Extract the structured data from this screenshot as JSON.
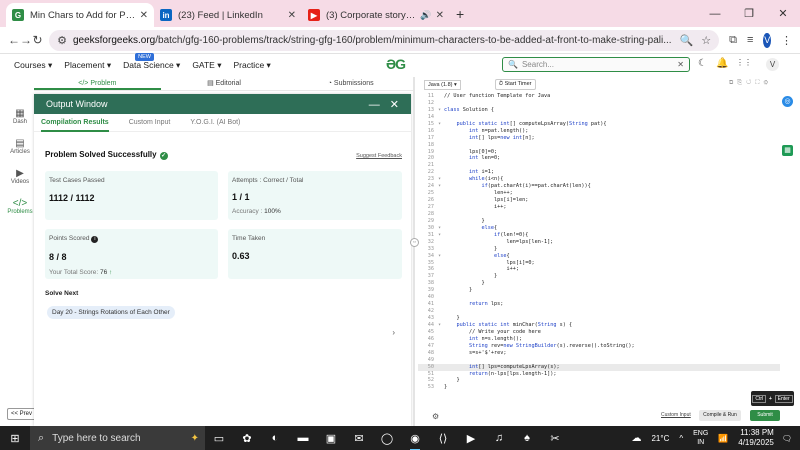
{
  "browser": {
    "tabs": [
      {
        "title": "Min Chars to Add for Palindrom",
        "active": true,
        "fav": "gg"
      },
      {
        "title": "(23) Feed | LinkedIn",
        "active": false,
        "fav": "in"
      },
      {
        "title": "(3) Corporate story | Standu",
        "active": false,
        "fav": "yt"
      }
    ],
    "url_domain": "geeksforgeeks.org",
    "url_path": "/batch/gfg-160-problems/track/string-gfg-160/problem/minimum-characters-to-be-added-at-front-to-make-string-pali...",
    "profile": "V"
  },
  "site": {
    "menu": [
      "Courses",
      "Placement",
      "Data Science",
      "GATE",
      "Practice"
    ],
    "new_badge": "NEW",
    "logo": "GG",
    "search_placeholder": "Search...",
    "profile": "V"
  },
  "problem_tabs": [
    "Problem",
    "Editorial",
    "Submissions"
  ],
  "sidebar": [
    {
      "icon": "▦",
      "label": "Dash"
    },
    {
      "icon": "▤",
      "label": "Articles"
    },
    {
      "icon": "▶",
      "label": "Videos"
    },
    {
      "icon": "</>",
      "label": "Problems"
    }
  ],
  "prev_label": "<< Prev",
  "output": {
    "title": "Output Window",
    "tabs": [
      "Compilation Results",
      "Custom Input",
      "Y.O.G.I. (AI Bot)"
    ],
    "status": "Problem Solved Successfully",
    "feedback": "Suggest Feedback",
    "test_cases_label": "Test Cases Passed",
    "test_cases_value": "1112 / 1112",
    "attempts_label": "Attempts : Correct / Total",
    "attempts_value": "1 / 1",
    "accuracy_label": "Accuracy :",
    "accuracy_value": "100%",
    "points_label": "Points Scored",
    "points_value": "8 / 8",
    "total_score_label": "Your Total Score:",
    "total_score_value": "76",
    "time_label": "Time Taken",
    "time_value": "0.63",
    "solve_next": "Solve Next",
    "next_problem": "Day 20 - Strings Rotations of Each Other"
  },
  "editor": {
    "language": "Java (1.8)",
    "timer": "Start Timer",
    "custom_input": "Custom Input",
    "compile_run": "Compile & Run",
    "submit": "Submit",
    "shortcut_ctrl": "Ctrl",
    "shortcut_plus": "+",
    "shortcut_enter": "Enter",
    "lines": [
      {
        "n": "11",
        "f": "",
        "t": "// User function Template for Java",
        "c": "cm"
      },
      {
        "n": "12",
        "f": "",
        "t": ""
      },
      {
        "n": "13",
        "f": "▾",
        "t": "class Solution {"
      },
      {
        "n": "14",
        "f": "",
        "t": ""
      },
      {
        "n": "15",
        "f": "▾",
        "t": "    public static int[] computeLpsArray(String pat){"
      },
      {
        "n": "16",
        "f": "",
        "t": "        int n=pat.length();"
      },
      {
        "n": "17",
        "f": "",
        "t": "        int[] lps=new int[n];"
      },
      {
        "n": "18",
        "f": "",
        "t": ""
      },
      {
        "n": "19",
        "f": "",
        "t": "        lps[0]=0;"
      },
      {
        "n": "20",
        "f": "",
        "t": "        int len=0;"
      },
      {
        "n": "21",
        "f": "",
        "t": ""
      },
      {
        "n": "22",
        "f": "",
        "t": "        int i=1;"
      },
      {
        "n": "23",
        "f": "▾",
        "t": "        while(i<n){"
      },
      {
        "n": "24",
        "f": "▾",
        "t": "            if(pat.charAt(i)==pat.charAt(len)){"
      },
      {
        "n": "25",
        "f": "",
        "t": "                len++;"
      },
      {
        "n": "26",
        "f": "",
        "t": "                lps[i]=len;"
      },
      {
        "n": "27",
        "f": "",
        "t": "                i++;"
      },
      {
        "n": "28",
        "f": "",
        "t": ""
      },
      {
        "n": "29",
        "f": "",
        "t": "            }"
      },
      {
        "n": "30",
        "f": "▾",
        "t": "            else{"
      },
      {
        "n": "31",
        "f": "▾",
        "t": "                if(len!=0){"
      },
      {
        "n": "32",
        "f": "",
        "t": "                    len=lps[len-1];"
      },
      {
        "n": "33",
        "f": "",
        "t": "                }"
      },
      {
        "n": "34",
        "f": "▾",
        "t": "                else{"
      },
      {
        "n": "35",
        "f": "",
        "t": "                    lps[i]=0;"
      },
      {
        "n": "36",
        "f": "",
        "t": "                    i++;"
      },
      {
        "n": "37",
        "f": "",
        "t": "                }"
      },
      {
        "n": "38",
        "f": "",
        "t": "            }"
      },
      {
        "n": "39",
        "f": "",
        "t": "        }"
      },
      {
        "n": "40",
        "f": "",
        "t": ""
      },
      {
        "n": "41",
        "f": "",
        "t": "        return lps;"
      },
      {
        "n": "42",
        "f": "",
        "t": ""
      },
      {
        "n": "43",
        "f": "",
        "t": "    }"
      },
      {
        "n": "44",
        "f": "▾",
        "t": "    public static int minChar(String s) {"
      },
      {
        "n": "45",
        "f": "",
        "t": "        // Write your code here",
        "c": "cm"
      },
      {
        "n": "46",
        "f": "",
        "t": "        int n=s.length();"
      },
      {
        "n": "47",
        "f": "",
        "t": "        String rev=new StringBuilder(s).reverse().toString();"
      },
      {
        "n": "48",
        "f": "",
        "t": "        s=s+'$'+rev;"
      },
      {
        "n": "49",
        "f": "",
        "t": ""
      },
      {
        "n": "50",
        "f": "",
        "t": "        int[] lps=computeLpsArray(s);",
        "hl": true
      },
      {
        "n": "51",
        "f": "",
        "t": "        return(n-lps[lps.length-1]);"
      },
      {
        "n": "52",
        "f": "",
        "t": "    }"
      },
      {
        "n": "53",
        "f": "",
        "t": "}"
      }
    ]
  },
  "taskbar": {
    "search_placeholder": "Type here to search",
    "weather": "21°C",
    "lang_top": "ENG",
    "lang_bottom": "IN",
    "time": "11:38 PM",
    "date": "4/19/2025"
  },
  "colors": {
    "brand": "#2f8d46",
    "header": "#2e6e57",
    "card": "#eef9f7"
  }
}
